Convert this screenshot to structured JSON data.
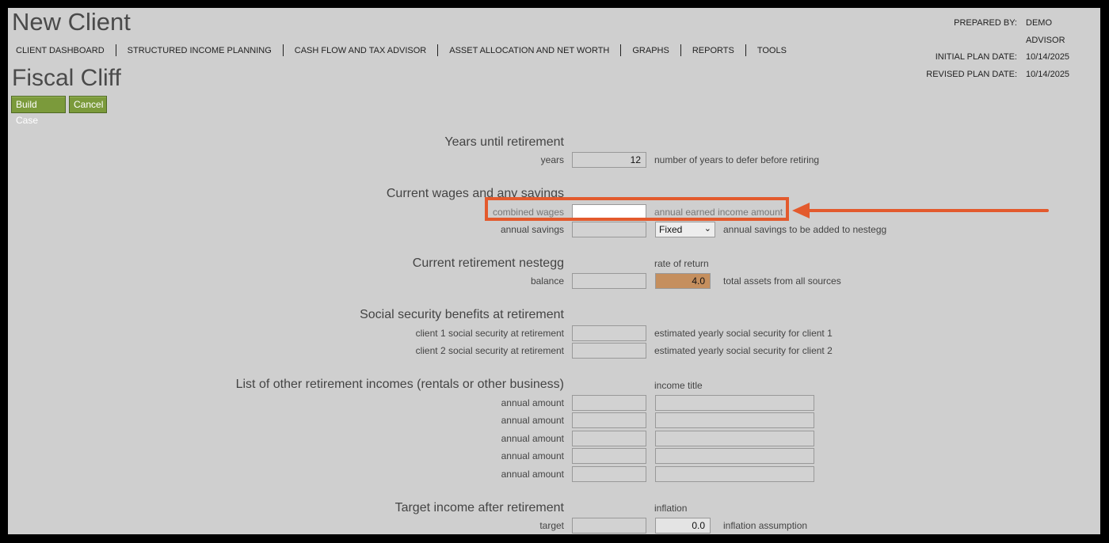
{
  "header": {
    "app_title": "New Client",
    "prepared_by_label": "PREPARED BY:",
    "prepared_by": "DEMO ADVISOR",
    "initial_plan_date_label": "INITIAL PLAN DATE:",
    "initial_plan_date": "10/14/2025",
    "revised_plan_date_label": "REVISED PLAN DATE:",
    "revised_plan_date": "10/14/2025"
  },
  "nav": [
    "CLIENT DASHBOARD",
    "STRUCTURED INCOME PLANNING",
    "CASH FLOW AND TAX ADVISOR",
    "ASSET ALLOCATION AND NET WORTH",
    "GRAPHS",
    "REPORTS",
    "TOOLS"
  ],
  "page": {
    "title": "Fiscal Cliff",
    "build_case_label": "Build Case",
    "cancel_label": "Cancel"
  },
  "retirement": {
    "heading": "Years until retirement",
    "years_label": "years",
    "years_value": "12",
    "years_desc": "number of years to defer before retiring"
  },
  "wages": {
    "heading": "Current wages and any savings",
    "combined_label": "combined wages",
    "combined_value": "",
    "combined_desc": "annual earned income amount",
    "savings_label": "annual savings",
    "savings_value": "",
    "savings_mode": "Fixed",
    "savings_desc": "annual savings to be added to nestegg"
  },
  "nestegg": {
    "heading": "Current retirement nestegg",
    "rate_label": "rate of return",
    "balance_label": "balance",
    "balance_value": "",
    "rate_value": "4.0",
    "desc": "total assets from all sources"
  },
  "social_security": {
    "heading": "Social security benefits at retirement",
    "client1_label": "client 1 social security at retirement",
    "client1_desc": "estimated yearly social security for client 1",
    "client2_label": "client 2 social security at retirement",
    "client2_desc": "estimated yearly social security for client 2"
  },
  "other_income": {
    "heading": "List of other retirement incomes (rentals or other business)",
    "title_label": "income title",
    "rows": [
      "annual amount",
      "annual amount",
      "annual amount",
      "annual amount",
      "annual amount"
    ]
  },
  "target": {
    "heading": "Target income after retirement",
    "inflation_label": "inflation",
    "target_label": "target",
    "inflation_value": "0.0",
    "desc": "inflation assumption"
  },
  "colors": {
    "highlight": "#e35a2d",
    "button": "#7b9a3b",
    "rate_field": "#c58f5e"
  }
}
